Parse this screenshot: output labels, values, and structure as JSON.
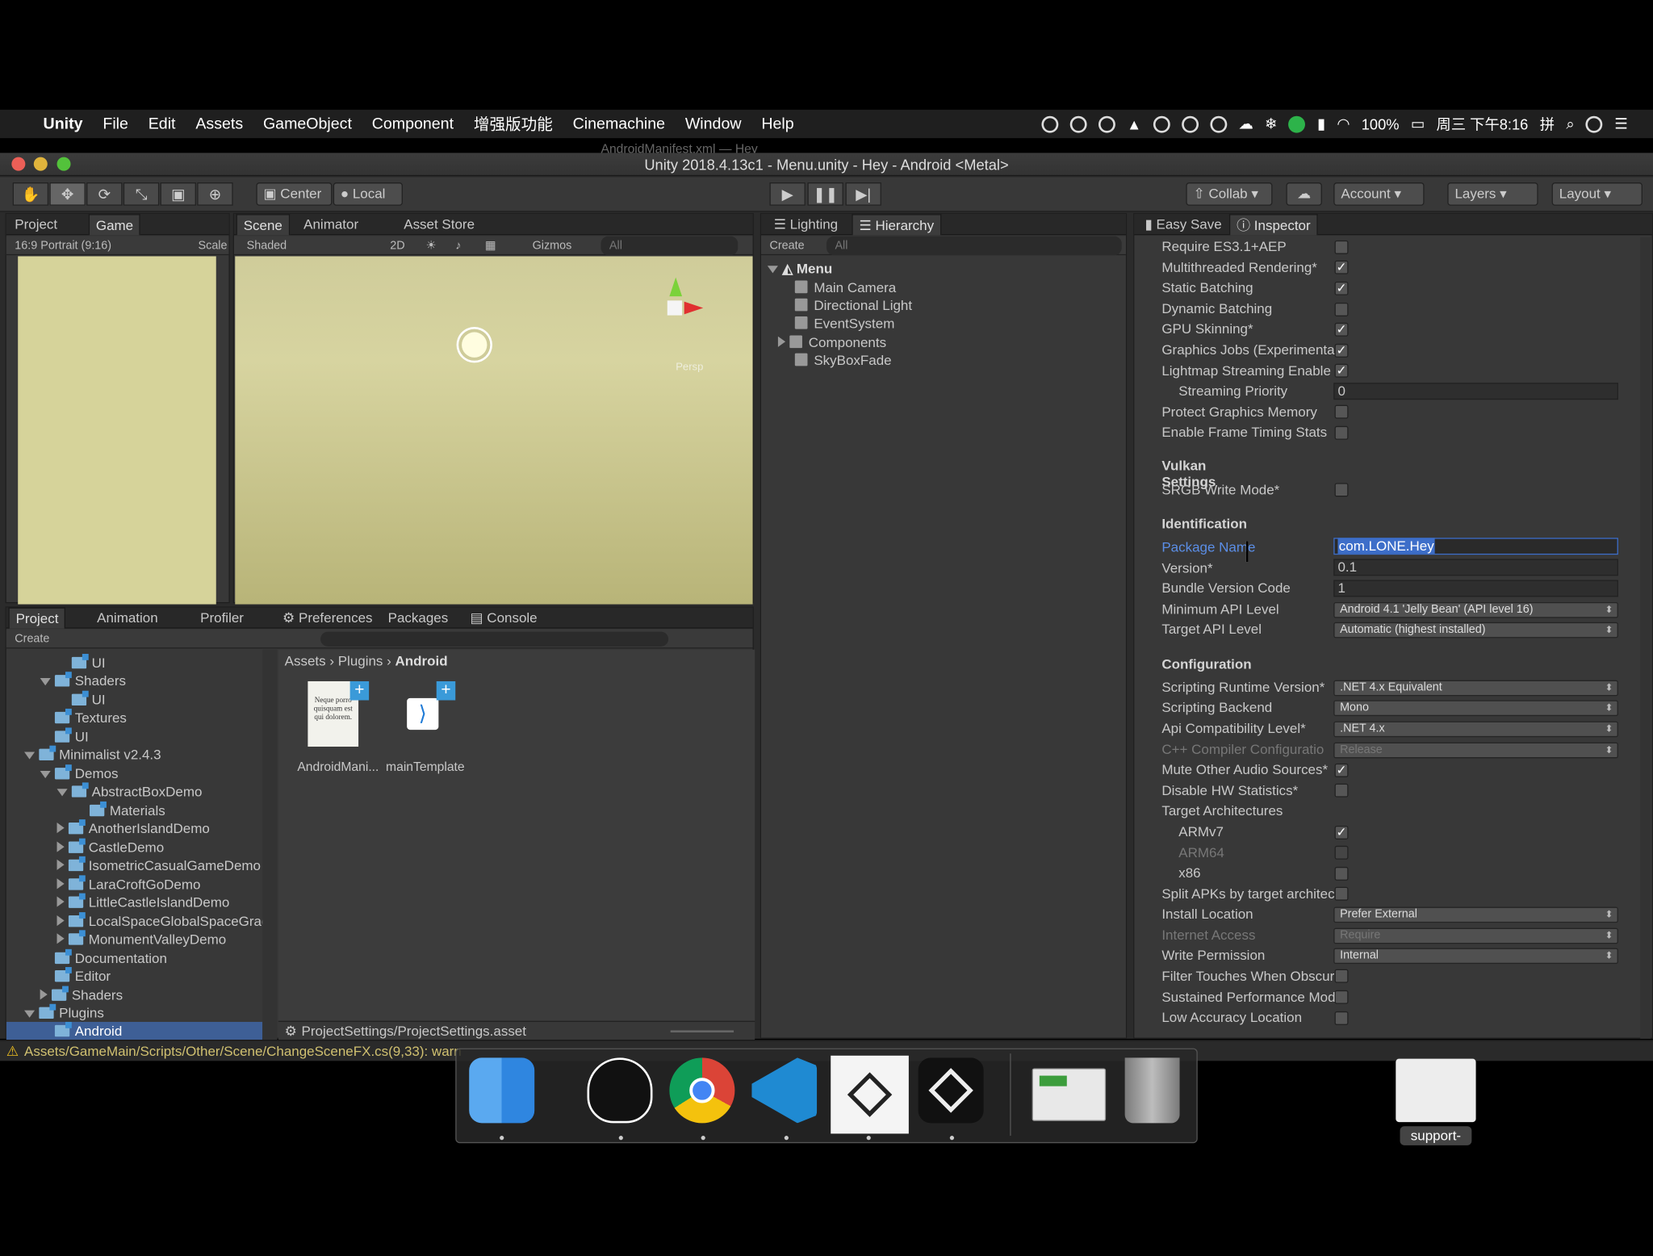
{
  "menubar": {
    "app": "Unity",
    "items": [
      "File",
      "Edit",
      "Assets",
      "GameObject",
      "Component",
      "增强版功能",
      "Cinemachine",
      "Window",
      "Help"
    ],
    "battery": "100%",
    "clock": "周三 下午8:16"
  },
  "window": {
    "title": "Unity 2018.4.13c1 - Menu.unity - Hey - Android <Metal>",
    "behind_title": "AndroidManifest.xml — Hey"
  },
  "toolbar": {
    "center": "Center",
    "local": "Local",
    "collab": "Collab",
    "account": "Account",
    "layers": "Layers",
    "layout": "Layout"
  },
  "game_panel": {
    "tabs": [
      "Project",
      "Game"
    ],
    "aspect": "16:9 Portrait (9:16)",
    "scale": "Scale"
  },
  "scene_panel": {
    "tabs": [
      "Scene",
      "Animator",
      "Asset Store"
    ],
    "shading": "Shaded",
    "mode_2d": "2D",
    "gizmos": "Gizmos",
    "search": "All",
    "persp": "Persp"
  },
  "hierarchy": {
    "tabs": [
      "Lighting",
      "Hierarchy"
    ],
    "create": "Create",
    "search": "All",
    "scene": "Menu",
    "items": [
      "Main Camera",
      "Directional Light",
      "EventSystem",
      "Components",
      "SkyBoxFade"
    ]
  },
  "project": {
    "tabs": [
      "Project",
      "Animation",
      "Profiler",
      "Preferences",
      "Packages",
      "Console"
    ],
    "create": "Create",
    "tree": [
      {
        "label": "UI",
        "depth": 4
      },
      {
        "label": "Shaders",
        "depth": 3,
        "open": true
      },
      {
        "label": "UI",
        "depth": 4
      },
      {
        "label": "Textures",
        "depth": 3
      },
      {
        "label": "UI",
        "depth": 3
      },
      {
        "label": "Minimalist v2.4.3",
        "depth": 1,
        "open": true
      },
      {
        "label": "Demos",
        "depth": 2,
        "open": true
      },
      {
        "label": "AbstractBoxDemo",
        "depth": 3,
        "open": true
      },
      {
        "label": "Materials",
        "depth": 5
      },
      {
        "label": "AnotherIslandDemo",
        "depth": 3,
        "closed": true
      },
      {
        "label": "CastleDemo",
        "depth": 3,
        "closed": true
      },
      {
        "label": "IsometricCasualGameDemo",
        "depth": 3,
        "closed": true
      },
      {
        "label": "LaraCroftGoDemo",
        "depth": 3,
        "closed": true
      },
      {
        "label": "LittleCastleIslandDemo",
        "depth": 3,
        "closed": true
      },
      {
        "label": "LocalSpaceGlobalSpaceGrad",
        "depth": 3,
        "closed": true
      },
      {
        "label": "MonumentValleyDemo",
        "depth": 3,
        "closed": true
      },
      {
        "label": "Documentation",
        "depth": 2
      },
      {
        "label": "Editor",
        "depth": 2
      },
      {
        "label": "Shaders",
        "depth": 2,
        "closed": true
      },
      {
        "label": "Plugins",
        "depth": 1,
        "open": true
      },
      {
        "label": "Android",
        "depth": 2,
        "selected": true
      }
    ],
    "breadcrumb": [
      "Assets",
      "Plugins",
      "Android"
    ],
    "files": [
      "AndroidMani...",
      "mainTemplate"
    ],
    "file_preview_text": "Neque porro quisquam est qui dolorem.",
    "footer": "ProjectSettings/ProjectSettings.asset"
  },
  "inspector": {
    "tabs": [
      "Easy Save",
      "Inspector"
    ],
    "rows": [
      {
        "label": "Require ES3.1+AEP",
        "type": "check",
        "checked": false
      },
      {
        "label": "Multithreaded Rendering*",
        "type": "check",
        "checked": true
      },
      {
        "label": "Static Batching",
        "type": "check",
        "checked": true
      },
      {
        "label": "Dynamic Batching",
        "type": "check",
        "checked": false
      },
      {
        "label": "GPU Skinning*",
        "type": "check",
        "checked": true
      },
      {
        "label": "Graphics Jobs (Experimental",
        "type": "check",
        "checked": true
      },
      {
        "label": "Lightmap Streaming Enable",
        "type": "check",
        "checked": true
      },
      {
        "label": "Streaming Priority",
        "type": "field",
        "value": "0",
        "indent": true
      },
      {
        "label": "Protect Graphics Memory",
        "type": "check",
        "checked": false
      },
      {
        "label": "Enable Frame Timing Stats",
        "type": "check",
        "checked": false
      },
      {
        "label": "Vulkan Settings",
        "type": "header"
      },
      {
        "label": "SRGB Write Mode*",
        "type": "check",
        "checked": false
      },
      {
        "label": "Identification",
        "type": "header"
      },
      {
        "label": "Package Name",
        "type": "field",
        "value": "com.LONE.Hey",
        "active": true
      },
      {
        "label": "Version*",
        "type": "field",
        "value": "0.1"
      },
      {
        "label": "Bundle Version Code",
        "type": "field",
        "value": "1"
      },
      {
        "label": "Minimum API Level",
        "type": "dropdown",
        "value": "Android 4.1 'Jelly Bean' (API level 16)"
      },
      {
        "label": "Target API Level",
        "type": "dropdown",
        "value": "Automatic (highest installed)"
      },
      {
        "label": "Configuration",
        "type": "header"
      },
      {
        "label": "Scripting Runtime Version*",
        "type": "dropdown",
        "value": ".NET 4.x Equivalent"
      },
      {
        "label": "Scripting Backend",
        "type": "dropdown",
        "value": "Mono"
      },
      {
        "label": "Api Compatibility Level*",
        "type": "dropdown",
        "value": ".NET 4.x"
      },
      {
        "label": "C++ Compiler Configuratio",
        "type": "dropdown",
        "value": "Release",
        "dim": true
      },
      {
        "label": "Mute Other Audio Sources*",
        "type": "check",
        "checked": true
      },
      {
        "label": "Disable HW Statistics*",
        "type": "check",
        "checked": false
      },
      {
        "label": "Target Architectures",
        "type": "label"
      },
      {
        "label": "ARMv7",
        "type": "check",
        "checked": true,
        "indent": true
      },
      {
        "label": "ARM64",
        "type": "check",
        "checked": false,
        "indent": true,
        "dim": true
      },
      {
        "label": "x86",
        "type": "check",
        "checked": false,
        "indent": true
      },
      {
        "label": "Split APKs by target architec",
        "type": "check",
        "checked": false
      },
      {
        "label": "Install Location",
        "type": "dropdown",
        "value": "Prefer External"
      },
      {
        "label": "Internet Access",
        "type": "dropdown",
        "value": "Require",
        "dim": true
      },
      {
        "label": "Write Permission",
        "type": "dropdown",
        "value": "Internal"
      },
      {
        "label": "Filter Touches When Obscur",
        "type": "check",
        "checked": false
      },
      {
        "label": "Sustained Performance Mod",
        "type": "check",
        "checked": false
      },
      {
        "label": "Low Accuracy Location",
        "type": "check",
        "checked": false
      }
    ]
  },
  "statusbar": {
    "message": "Assets/GameMain/Scripts/Other/Scene/ChangeSceneFX.cs(9,33): warn"
  },
  "dock": {
    "apps": [
      "finder-icon",
      "qq-icon",
      "chrome-icon",
      "vscode-icon",
      "unity-hub-icon",
      "unity-icon",
      "screenshot-icon",
      "trash-icon"
    ],
    "file_label": "support-"
  },
  "colors": {
    "accent": "#3d6ec9",
    "selection": "#3e5f96",
    "game_view": "#d6d39a",
    "link": "#5b8ee6"
  }
}
